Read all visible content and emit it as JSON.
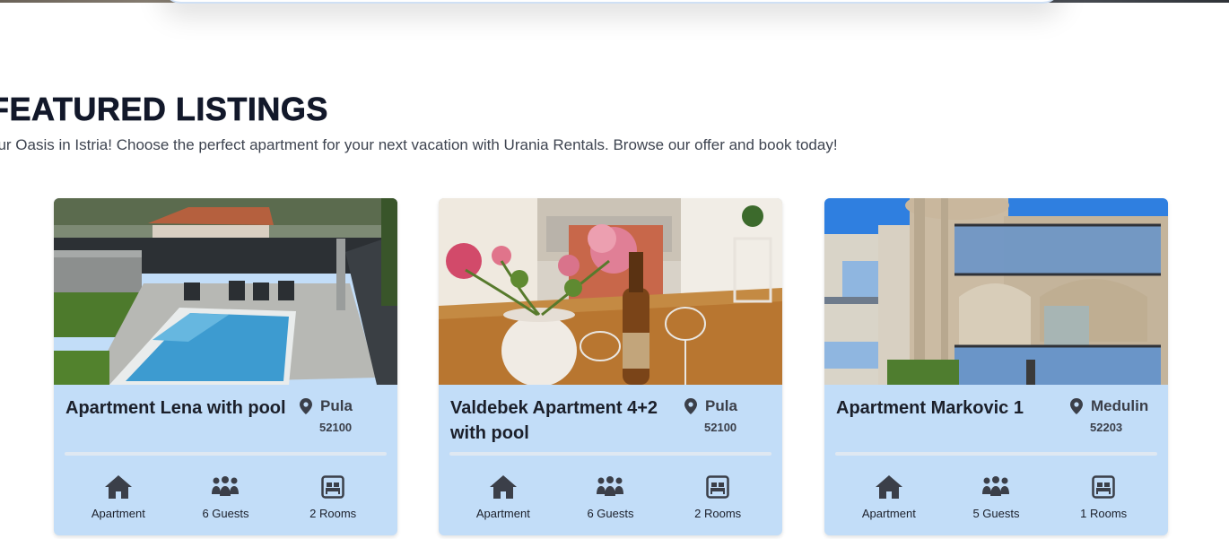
{
  "section": {
    "title": "FEATURED LISTINGS",
    "intro": "our Oasis in Istria! Choose the perfect apartment for your next vacation with Urania Rentals. Browse our offer and book today!"
  },
  "listings": [
    {
      "title": "Apartment Lena with pool",
      "city": "Pula",
      "zip": "52100",
      "type": "Apartment",
      "guests": "6 Guests",
      "rooms": "2 Rooms",
      "image": "pool-villa-photo"
    },
    {
      "title": "Valdebek Apartment 4+2 with pool",
      "city": "Pula",
      "zip": "52100",
      "type": "Apartment",
      "guests": "6 Guests",
      "rooms": "2 Rooms",
      "image": "dining-table-flowers-photo"
    },
    {
      "title": "Apartment Markovic 1",
      "city": "Medulin",
      "zip": "52203",
      "type": "Apartment",
      "guests": "5 Guests",
      "rooms": "1 Rooms",
      "image": "stone-house-balconies-photo"
    }
  ],
  "icons": {
    "location": "map-pin-icon",
    "type": "home-icon",
    "guests": "users-icon",
    "rooms": "bed-icon"
  },
  "colors": {
    "card_bg": "#c2ddf8",
    "title": "#12182a",
    "icon": "#3b3f49"
  }
}
